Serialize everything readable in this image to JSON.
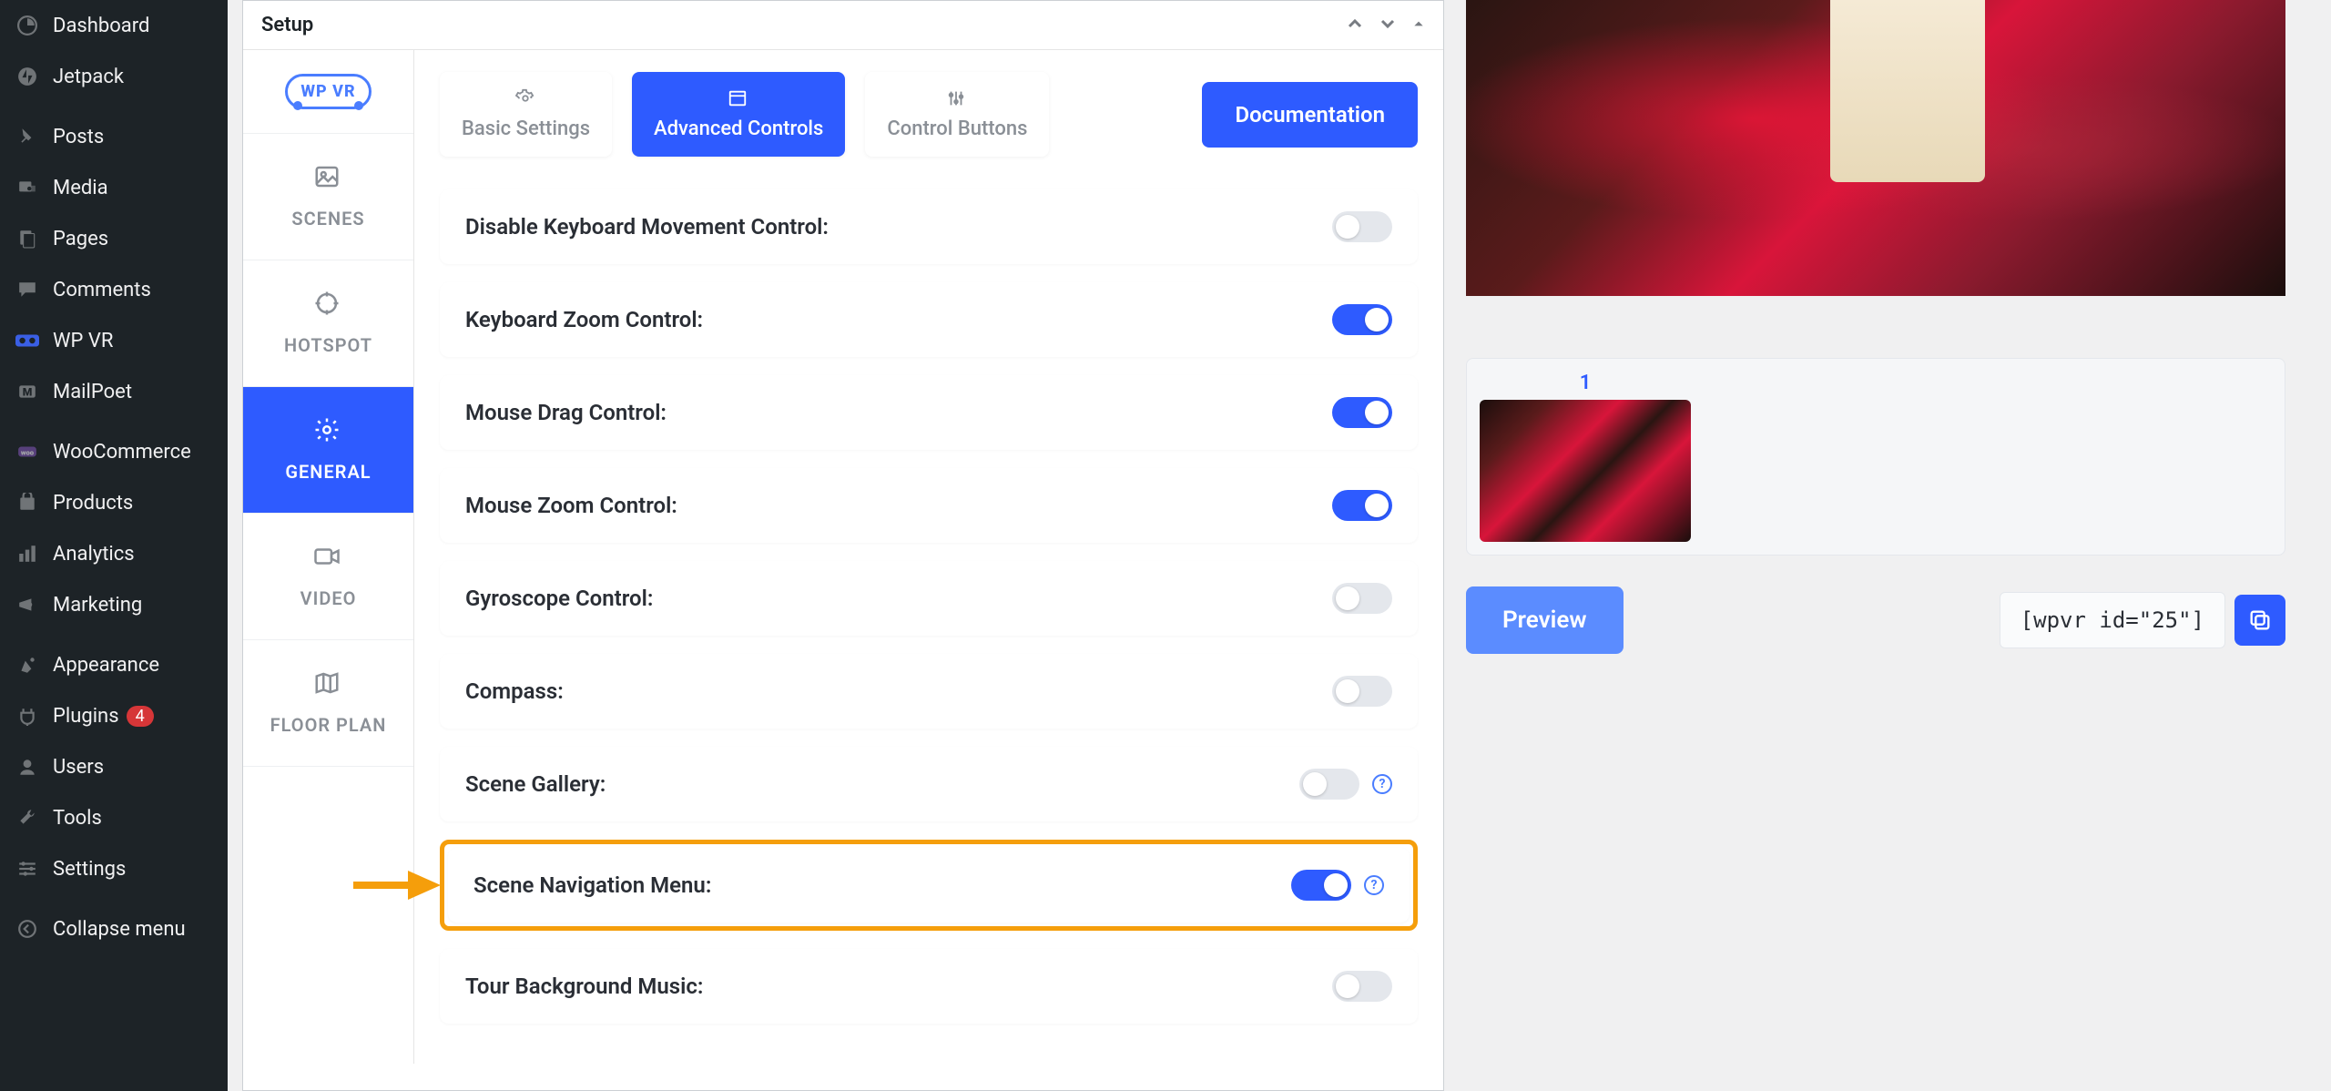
{
  "wp_menu": [
    {
      "label": "Dashboard",
      "icon": "dashboard"
    },
    {
      "label": "Jetpack",
      "icon": "jetpack"
    },
    {
      "label": "Posts",
      "icon": "posts"
    },
    {
      "label": "Media",
      "icon": "media"
    },
    {
      "label": "Pages",
      "icon": "pages"
    },
    {
      "label": "Comments",
      "icon": "comments"
    },
    {
      "label": "WP VR",
      "icon": "wpvr"
    },
    {
      "label": "MailPoet",
      "icon": "mailpoet"
    },
    {
      "label": "WooCommerce",
      "icon": "woo"
    },
    {
      "label": "Products",
      "icon": "products"
    },
    {
      "label": "Analytics",
      "icon": "analytics"
    },
    {
      "label": "Marketing",
      "icon": "marketing"
    },
    {
      "label": "Appearance",
      "icon": "appearance"
    },
    {
      "label": "Plugins",
      "icon": "plugins",
      "badge": "4"
    },
    {
      "label": "Users",
      "icon": "users"
    },
    {
      "label": "Tools",
      "icon": "tools"
    },
    {
      "label": "Settings",
      "icon": "settings"
    },
    {
      "label": "Collapse menu",
      "icon": "collapse"
    }
  ],
  "metabox": {
    "title": "Setup"
  },
  "vtabs": [
    {
      "label": "SCENES",
      "icon": "image"
    },
    {
      "label": "HOTSPOT",
      "icon": "target"
    },
    {
      "label": "GENERAL",
      "icon": "gear",
      "active": true
    },
    {
      "label": "VIDEO",
      "icon": "video"
    },
    {
      "label": "FLOOR PLAN",
      "icon": "map"
    }
  ],
  "logo_text": "WP VR",
  "top_tabs": [
    {
      "label": "Basic Settings"
    },
    {
      "label": "Advanced Controls",
      "active": true
    },
    {
      "label": "Control Buttons"
    }
  ],
  "doc_btn": "Documentation",
  "settings": [
    {
      "label": "Disable Keyboard Movement Control:",
      "on": false
    },
    {
      "label": "Keyboard Zoom Control:",
      "on": true
    },
    {
      "label": "Mouse Drag Control:",
      "on": true
    },
    {
      "label": "Mouse Zoom Control:",
      "on": true
    },
    {
      "label": "Gyroscope Control:",
      "on": false
    },
    {
      "label": "Compass:",
      "on": false
    },
    {
      "label": "Scene Gallery:",
      "on": false,
      "info": true
    },
    {
      "label": "Scene Navigation Menu:",
      "on": true,
      "info": true,
      "callout": true
    },
    {
      "label": "Tour Background Music:",
      "on": false
    }
  ],
  "scene_strip": {
    "num": "1"
  },
  "preview_btn": "Preview",
  "shortcode": "[wpvr id=\"25\"]"
}
